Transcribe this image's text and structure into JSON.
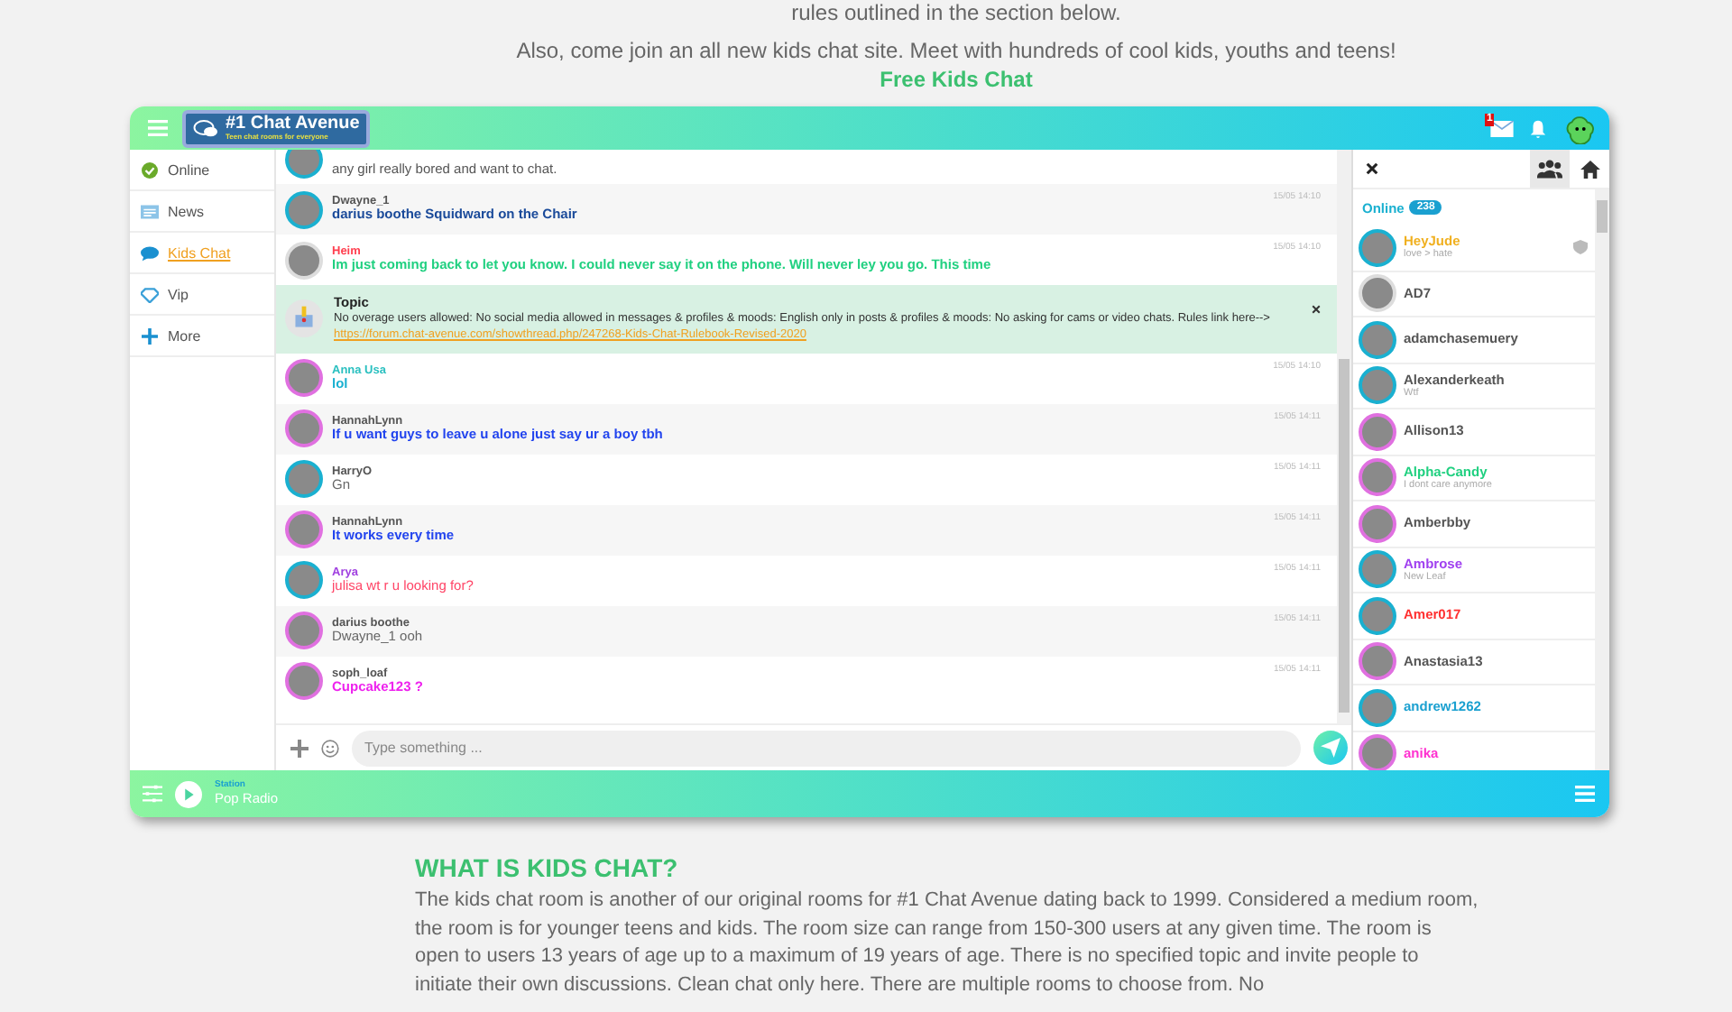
{
  "intro": {
    "cut_line": "rules outlined in the section below.",
    "text": "Also, come join an all new kids chat site. Meet with hundreds of cool kids, youths and teens!",
    "link": "Free Kids Chat"
  },
  "chat": {
    "logo": {
      "title": "#1 Chat Avenue",
      "tagline": "Teen chat rooms for everyone"
    },
    "mail_badge": "1",
    "sidebar": [
      {
        "label": "Online",
        "selected": false
      },
      {
        "label": "News",
        "selected": false
      },
      {
        "label": "Kids Chat",
        "selected": true
      },
      {
        "label": "Vip",
        "selected": false
      },
      {
        "label": "More",
        "selected": false
      }
    ],
    "messages": [
      {
        "kind": "message",
        "avatar": {
          "color": "#1ab0d0"
        },
        "body": {
          "text": "any girl really bored and want to chat.",
          "color": "#555555",
          "bold": false
        }
      },
      {
        "kind": "message",
        "avatar": {
          "color": "#1ab0d0"
        },
        "author": {
          "name": "Dwayne_1",
          "color": "#555555"
        },
        "body": {
          "text": "darius boothe Squidward on the Chair",
          "color": "#1a4a9a",
          "bold": true
        },
        "time": "15/05 14:10"
      },
      {
        "kind": "message",
        "avatar": {
          "color": "#dddddd"
        },
        "author": {
          "name": "Heim",
          "color": "#ff4050"
        },
        "body": {
          "text": "Im just coming back to let you know. I could never say it on the phone. Will never ley you go. This time",
          "color": "#20d080",
          "bold": true
        },
        "time": "15/05 14:10"
      },
      {
        "kind": "topic",
        "title": "Topic",
        "text": "No overage users allowed: No social media allowed in messages & profiles & moods: English only in posts & profiles & moods: No asking for cams or video chats. Rules link here-->",
        "link": "https://forum.chat-avenue.com/showthread.php/247268-Kids-Chat-Rulebook-Revised-2020"
      },
      {
        "kind": "message",
        "avatar": {
          "color": "#e070e0"
        },
        "author": {
          "name": "Anna Usa",
          "color": "#2bc0c0"
        },
        "body": {
          "text": "lol",
          "color": "#1ab0d0",
          "bold": true
        },
        "time": "15/05 14:10"
      },
      {
        "kind": "message",
        "avatar": {
          "color": "#e070e0"
        },
        "author": {
          "name": "HannahLynn",
          "color": "#555555"
        },
        "body": {
          "text": "If u want guys to leave u alone just say ur a boy tbh",
          "color": "#2244ee",
          "bold": true
        },
        "time": "15/05 14:11"
      },
      {
        "kind": "message",
        "avatar": {
          "color": "#1ab0d0"
        },
        "author": {
          "name": "HarryO",
          "color": "#555555"
        },
        "body": {
          "text": "Gn",
          "color": "#666666",
          "bold": false
        },
        "time": "15/05 14:11"
      },
      {
        "kind": "message",
        "avatar": {
          "color": "#e070e0"
        },
        "author": {
          "name": "HannahLynn",
          "color": "#555555"
        },
        "body": {
          "text": "It works every time",
          "color": "#2244ee",
          "bold": true
        },
        "time": "15/05 14:11"
      },
      {
        "kind": "message",
        "avatar": {
          "color": "#1ab0d0"
        },
        "author": {
          "name": "Arya",
          "color": "#a040e0"
        },
        "body": {
          "text": "julisa wt r u looking for?",
          "color": "#ff4466",
          "bold": false
        },
        "time": "15/05 14:11"
      },
      {
        "kind": "message",
        "avatar": {
          "color": "#e070e0"
        },
        "author": {
          "name": "darius boothe",
          "color": "#555555"
        },
        "body": {
          "text": "Dwayne_1 ooh",
          "color": "#666666",
          "bold": false
        },
        "time": "15/05 14:11"
      },
      {
        "kind": "message",
        "avatar": {
          "color": "#e070e0"
        },
        "author": {
          "name": "soph_loaf",
          "color": "#555555"
        },
        "body": {
          "text": "Cupcake123 ?",
          "color": "#ee22ee",
          "bold": true
        },
        "time": "15/05 14:11"
      }
    ],
    "input": {
      "placeholder": "Type something ..."
    },
    "panel": {
      "online_label": "Online",
      "online_count": "238",
      "users": [
        {
          "name": "HeyJude",
          "color": "#f0b020",
          "mood": "love > hate",
          "avatar": {
            "color": "#1ab0d0"
          }
        },
        {
          "name": "AD7",
          "color": "#555555",
          "avatar": {
            "color": "#dddddd"
          }
        },
        {
          "name": "adamchasemuery",
          "color": "#555555",
          "avatar": {
            "color": "#1ab0d0"
          }
        },
        {
          "name": "Alexanderkeath",
          "color": "#555555",
          "mood": "Wtf",
          "avatar": {
            "color": "#1ab0d0"
          }
        },
        {
          "name": "Allison13",
          "color": "#555555",
          "avatar": {
            "color": "#e070e0"
          }
        },
        {
          "name": "Alpha-Candy",
          "color": "#20d080",
          "mood": "I dont care anymore",
          "avatar": {
            "color": "#e070e0"
          }
        },
        {
          "name": "Amberbby",
          "color": "#555555",
          "avatar": {
            "color": "#e070e0"
          }
        },
        {
          "name": "Ambrose",
          "color": "#a040f0",
          "mood": "New Leaf",
          "avatar": {
            "color": "#1ab0d0"
          }
        },
        {
          "name": "Amer017",
          "color": "#ff3030",
          "avatar": {
            "color": "#1ab0d0"
          }
        },
        {
          "name": "Anastasia13",
          "color": "#555555",
          "avatar": {
            "color": "#e070e0"
          }
        },
        {
          "name": "andrew1262",
          "color": "#1aa0d0",
          "avatar": {
            "color": "#1ab0d0"
          }
        },
        {
          "name": "anika",
          "color": "#ff30d0",
          "avatar": {
            "color": "#e070e0"
          }
        }
      ]
    },
    "player": {
      "label": "Station",
      "station": "Pop Radio"
    }
  },
  "article": {
    "heading": "WHAT IS KIDS CHAT?",
    "text": "The kids chat room is another of our original rooms for #1 Chat Avenue dating back to 1999. Considered a medium room, the room is for younger teens and kids. The room size can range from 150-300 users at any given time. The room is open to users 13 years of age up to a maximum of 19 years of age. There is no specified topic and invite people to initiate their own discussions. Clean chat only here. There are multiple rooms to choose from. No"
  }
}
